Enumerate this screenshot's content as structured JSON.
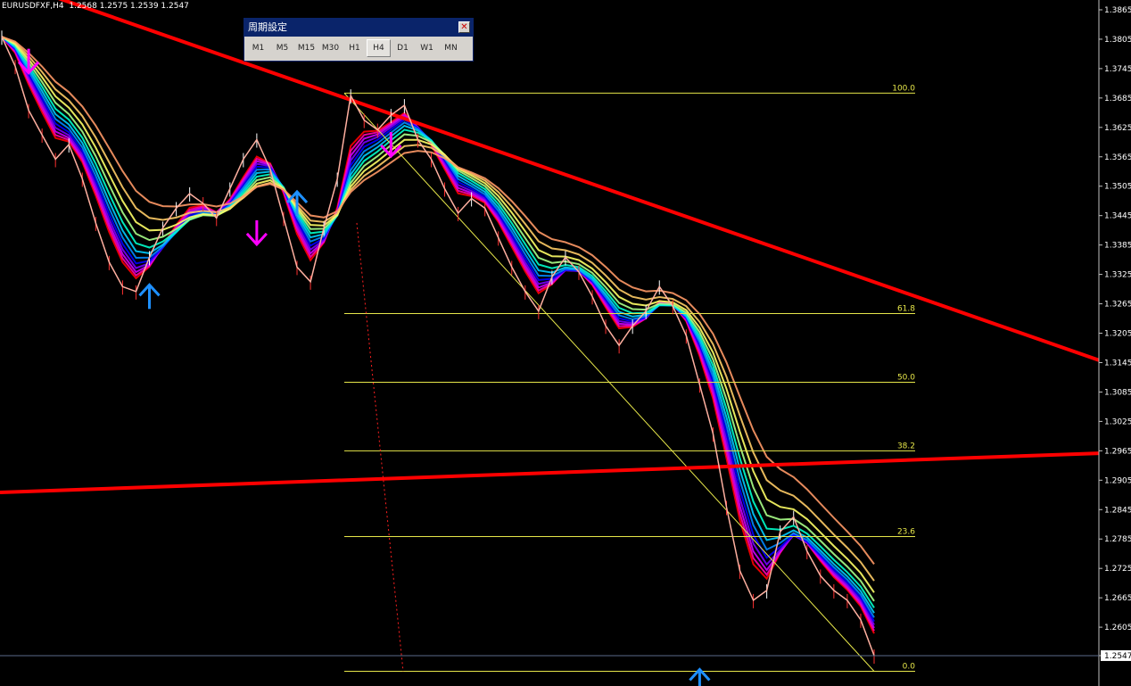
{
  "header": {
    "symbol_info": "EURUSDFXF,H4  1.2568 1.2575 1.2539 1.2547"
  },
  "dialog": {
    "title": "周期設定",
    "close_label": "✕",
    "timeframes": [
      "M1",
      "M5",
      "M15",
      "M30",
      "H1",
      "H4",
      "D1",
      "W1",
      "MN"
    ],
    "active": "H4"
  },
  "chart_data": {
    "type": "line",
    "title": "",
    "ylim": [
      1.2485,
      1.3885
    ],
    "y_ticks": [
      1.3865,
      1.3805,
      1.3745,
      1.3685,
      1.3625,
      1.3565,
      1.3505,
      1.3445,
      1.3385,
      1.3325,
      1.3265,
      1.3205,
      1.3145,
      1.3085,
      1.3025,
      1.2965,
      1.2905,
      1.2845,
      1.2785,
      1.2725,
      1.2665,
      1.2605,
      1.2547
    ],
    "current_price": "1.2547",
    "fibonacci": [
      {
        "level": "100.0",
        "price": 1.3695
      },
      {
        "level": "61.8",
        "price": 1.3245
      },
      {
        "level": "50.0",
        "price": 1.3105
      },
      {
        "level": "38.2",
        "price": 1.2965
      },
      {
        "level": "23.6",
        "price": 1.279
      },
      {
        "level": "0.0",
        "price": 1.2515
      }
    ],
    "price_series": [
      1.381,
      1.375,
      1.366,
      1.361,
      1.356,
      1.359,
      1.352,
      1.343,
      1.335,
      1.33,
      1.329,
      1.336,
      1.342,
      1.346,
      1.349,
      1.347,
      1.344,
      1.35,
      1.356,
      1.36,
      1.354,
      1.344,
      1.334,
      1.331,
      1.342,
      1.352,
      1.369,
      1.364,
      1.362,
      1.365,
      1.367,
      1.36,
      1.356,
      1.35,
      1.345,
      1.348,
      1.346,
      1.34,
      1.334,
      1.329,
      1.325,
      1.332,
      1.336,
      1.333,
      1.328,
      1.322,
      1.318,
      1.322,
      1.325,
      1.33,
      1.326,
      1.32,
      1.31,
      1.3,
      1.285,
      1.272,
      1.266,
      1.268,
      1.28,
      1.283,
      1.276,
      1.271,
      1.268,
      1.266,
      1.262,
      1.2547
    ],
    "ribbon_colors": [
      "#ff0000",
      "#ff00aa",
      "#cc00ff",
      "#7700ff",
      "#0000ff",
      "#0088ff",
      "#00ccff",
      "#00ffcc",
      "#aaff88",
      "#ffff66",
      "#ffcc66",
      "#ff9966"
    ],
    "trendlines": [
      {
        "from": [
          0,
          1.393
        ],
        "to": [
          65,
          1.315
        ],
        "color": "#ff0000"
      },
      {
        "from": [
          0,
          1.288
        ],
        "to": [
          65,
          1.296
        ],
        "color": "#ff0000"
      }
    ],
    "arrows": [
      {
        "dir": "down",
        "x": 2,
        "price": 1.376,
        "color": "#ff00ff"
      },
      {
        "dir": "up",
        "x": 11,
        "price": 1.328,
        "color": "#1e90ff"
      },
      {
        "dir": "down",
        "x": 19,
        "price": 1.341,
        "color": "#ff00ff"
      },
      {
        "dir": "up",
        "x": 22,
        "price": 1.347,
        "color": "#1e90ff"
      },
      {
        "dir": "down",
        "x": 29,
        "price": 1.359,
        "color": "#ff00ff"
      },
      {
        "dir": "up",
        "x": 52,
        "price": 1.2495,
        "color": "#1e90ff"
      }
    ]
  }
}
